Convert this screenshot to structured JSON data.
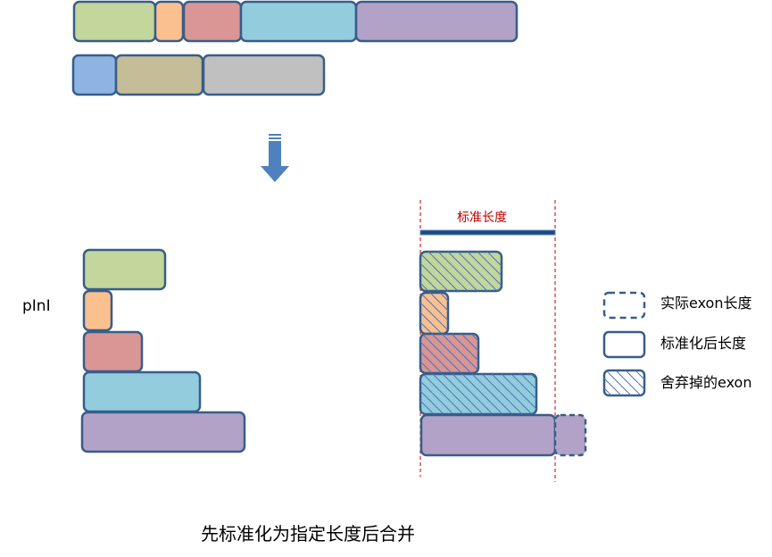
{
  "colors": {
    "green": "#c3d69b",
    "orange": "#fac090",
    "red": "#d99694",
    "blue": "#93cddd",
    "purple": "#b3a2c7",
    "cornflower": "#8eb4e3",
    "tan": "#c4bd97",
    "gray": "#c0c0c0",
    "outline": "#385d8a",
    "arrow": "#4f81bd",
    "guide": "#c00000",
    "standard_bar": "#1f497d"
  },
  "labels": {
    "row_label": "pInI",
    "standard_length": "标准长度",
    "caption": "先标准化为指定长度后合并"
  },
  "legend": [
    {
      "style": "dashed",
      "label": "实际exon长度"
    },
    {
      "style": "solid",
      "label": "标准化后长度"
    },
    {
      "style": "hatched",
      "label": "舍弃掉的exon"
    }
  ],
  "icons": {
    "arrow": "down-arrow-icon"
  }
}
